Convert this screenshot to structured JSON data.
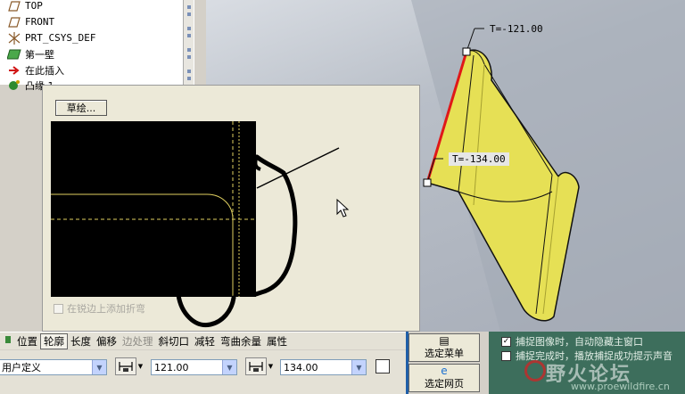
{
  "model_tree": {
    "items": [
      {
        "label": "TOP",
        "icon": "datum-plane-icon"
      },
      {
        "label": "FRONT",
        "icon": "datum-plane-icon"
      },
      {
        "label": "PRT_CSYS_DEF",
        "icon": "coordinate-system-icon"
      },
      {
        "label": "第一壁",
        "icon": "wall-feature-icon"
      },
      {
        "label": "在此插入",
        "icon": "insert-here-arrow-icon"
      },
      {
        "label": "凸缘 1",
        "icon": "flange-feature-icon"
      }
    ]
  },
  "viewport": {
    "dim_top": "T=-121.00",
    "dim_bottom": "T=-134.00",
    "part_color": "#e6e055",
    "edge_color": "#e01818"
  },
  "sketch_dialog": {
    "sketch_button": "草绘...",
    "corner_relief_check": "在锐边上添加折弯"
  },
  "dashboard": {
    "tabs": [
      "位置",
      "轮廓",
      "长度",
      "偏移",
      "边处理",
      "斜切口",
      "减轻",
      "弯曲余量",
      "属性"
    ],
    "active_tab": "轮廓",
    "disabled_tab": "边处理",
    "profile_type": "用户定义",
    "length_1": "121.00",
    "length_2": "134.00"
  },
  "menu_buttons": {
    "select_menu": "选定菜单",
    "select_web": "选定网页"
  },
  "options": {
    "auto_hide": "捕捉图像时，自动隐藏主窗口",
    "auto_hide_checked": "✓",
    "sound_prompt": "捕捉完成时，播放捕捉成功提示声音"
  },
  "watermark": {
    "text": "野火论坛",
    "url": "www.proewildfire.cn"
  }
}
